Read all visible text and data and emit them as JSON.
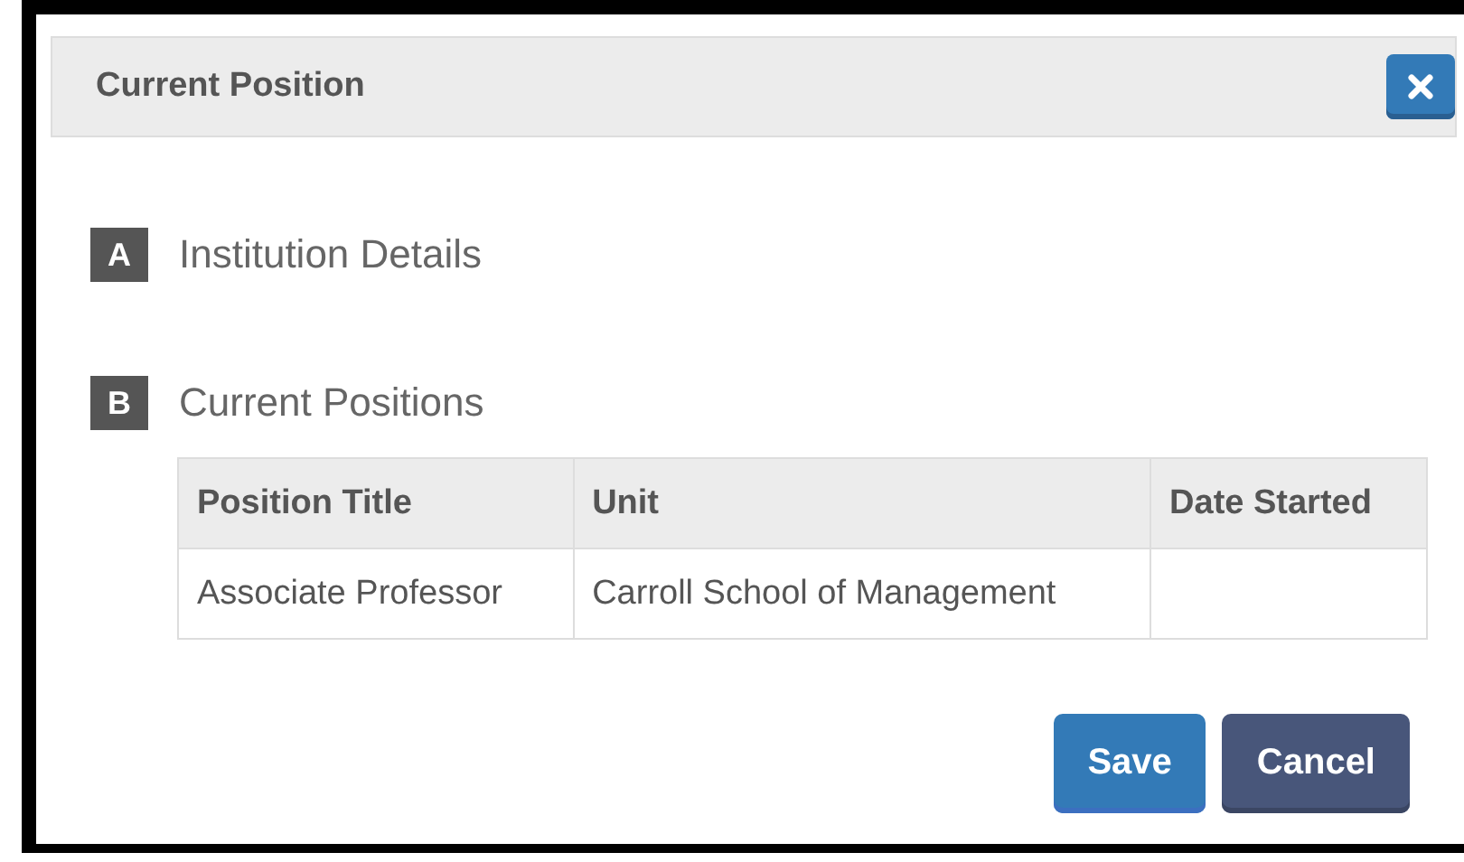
{
  "dialog": {
    "title": "Current Position"
  },
  "sections": [
    {
      "letter": "A",
      "title": "Institution Details"
    },
    {
      "letter": "B",
      "title": "Current Positions",
      "table": {
        "columns": [
          "Position Title",
          "Unit",
          "Date Started"
        ],
        "rows": [
          [
            "Associate Professor",
            "Carroll School of Management",
            ""
          ]
        ]
      }
    }
  ],
  "buttons": [
    {
      "label": "Save",
      "kind": "primary"
    },
    {
      "label": "Cancel",
      "kind": "secondary"
    }
  ]
}
